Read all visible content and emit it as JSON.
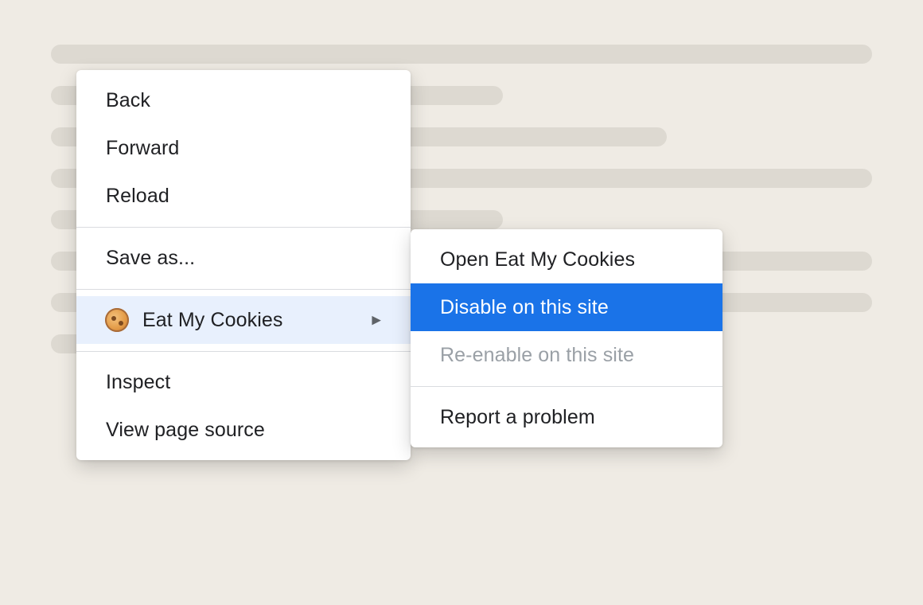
{
  "main_menu": {
    "items": [
      {
        "label": "Back"
      },
      {
        "label": "Forward"
      },
      {
        "label": "Reload"
      },
      {
        "label": "Save as..."
      },
      {
        "label": "Eat My Cookies",
        "icon": "cookie-icon",
        "has_submenu": true
      },
      {
        "label": "Inspect"
      },
      {
        "label": "View page source"
      }
    ]
  },
  "submenu": {
    "items": [
      {
        "label": "Open Eat My Cookies"
      },
      {
        "label": "Disable on this site",
        "state": "highlighted"
      },
      {
        "label": "Re-enable on this site",
        "state": "disabled"
      },
      {
        "label": "Report a problem"
      }
    ]
  },
  "icons": {
    "submenu_arrow": "▶"
  },
  "colors": {
    "background": "#efebe4",
    "placeholder": "#ddd9d1",
    "menu_background": "#ffffff",
    "highlight": "#1a73e8",
    "hover": "#e8f0fd",
    "text": "#202124",
    "disabled_text": "#9aa0a6"
  }
}
